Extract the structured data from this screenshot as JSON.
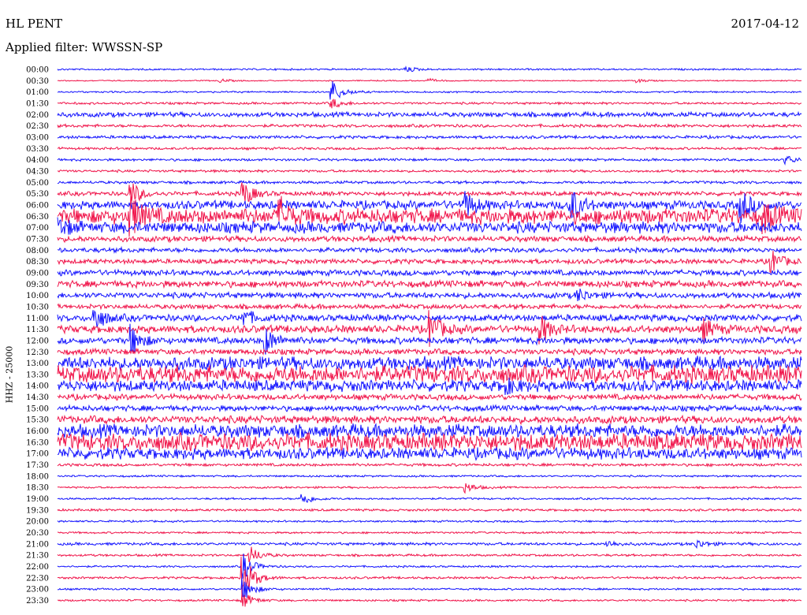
{
  "header": {
    "station": "HL PENT",
    "date": "2017-04-12",
    "filter": "Applied filter: WWSSN-SP",
    "channel": "HHZ - 25000"
  },
  "colors": {
    "trace_a": "#1414ff",
    "trace_b": "#f0144a",
    "background": "#ffffff"
  },
  "chart_data": {
    "type": "line",
    "title": "HL PENT",
    "subtitle": "Applied filter: WWSSN-SP",
    "ylabel": "HHZ - 25000",
    "xlabel": "",
    "grid": false,
    "trace_duration_minutes": 30,
    "color_cycle": [
      "#1414ff",
      "#f0144a"
    ],
    "rows": [
      {
        "time": "00:00",
        "noise": 0.9,
        "events": [
          {
            "t": 0.47,
            "amp": 3
          }
        ]
      },
      {
        "time": "00:30",
        "noise": 0.6,
        "events": [
          {
            "t": 0.22,
            "amp": 2
          },
          {
            "t": 0.5,
            "amp": 2
          },
          {
            "t": 0.78,
            "amp": 2
          }
        ]
      },
      {
        "time": "01:00",
        "noise": 0.9,
        "events": [
          {
            "t": 0.37,
            "amp": 14
          }
        ]
      },
      {
        "time": "01:30",
        "noise": 1.2,
        "events": [
          {
            "t": 0.37,
            "amp": 6
          }
        ]
      },
      {
        "time": "02:00",
        "noise": 2.5,
        "events": []
      },
      {
        "time": "02:30",
        "noise": 1.6,
        "events": []
      },
      {
        "time": "03:00",
        "noise": 1.6,
        "events": []
      },
      {
        "time": "03:30",
        "noise": 1.3,
        "events": []
      },
      {
        "time": "04:00",
        "noise": 1.3,
        "events": [
          {
            "t": 0.98,
            "amp": 5
          }
        ]
      },
      {
        "time": "04:30",
        "noise": 1.3,
        "events": []
      },
      {
        "time": "05:00",
        "noise": 1.5,
        "events": []
      },
      {
        "time": "05:30",
        "noise": 2.2,
        "events": [
          {
            "t": 0.1,
            "amp": 14
          },
          {
            "t": 0.25,
            "amp": 16
          }
        ]
      },
      {
        "time": "06:00",
        "noise": 4.5,
        "events": [
          {
            "t": 0.55,
            "amp": 15
          },
          {
            "t": 0.69,
            "amp": 22
          },
          {
            "t": 0.92,
            "amp": 18
          }
        ]
      },
      {
        "time": "06:30",
        "noise": 8,
        "events": [
          {
            "t": 0.1,
            "amp": 24
          },
          {
            "t": 0.3,
            "amp": 18
          },
          {
            "t": 0.95,
            "amp": 16
          }
        ]
      },
      {
        "time": "07:00",
        "noise": 6,
        "events": [
          {
            "t": 0.0,
            "amp": 12
          }
        ]
      },
      {
        "time": "07:30",
        "noise": 3,
        "events": []
      },
      {
        "time": "08:00",
        "noise": 2.5,
        "events": []
      },
      {
        "time": "08:30",
        "noise": 2.5,
        "events": [
          {
            "t": 0.96,
            "amp": 14
          }
        ]
      },
      {
        "time": "09:00",
        "noise": 3,
        "events": []
      },
      {
        "time": "09:30",
        "noise": 3.5,
        "events": []
      },
      {
        "time": "10:00",
        "noise": 3,
        "events": [
          {
            "t": 0.7,
            "amp": 8
          }
        ]
      },
      {
        "time": "10:30",
        "noise": 2.5,
        "events": []
      },
      {
        "time": "11:00",
        "noise": 3.5,
        "events": [
          {
            "t": 0.05,
            "amp": 16
          },
          {
            "t": 0.25,
            "amp": 10
          }
        ]
      },
      {
        "time": "11:30",
        "noise": 4,
        "events": [
          {
            "t": 0.5,
            "amp": 22
          },
          {
            "t": 0.65,
            "amp": 16
          },
          {
            "t": 0.87,
            "amp": 12
          }
        ]
      },
      {
        "time": "12:00",
        "noise": 3.5,
        "events": [
          {
            "t": 0.1,
            "amp": 18
          },
          {
            "t": 0.28,
            "amp": 16
          }
        ]
      },
      {
        "time": "12:30",
        "noise": 3,
        "events": []
      },
      {
        "time": "13:00",
        "noise": 7,
        "events": []
      },
      {
        "time": "13:30",
        "noise": 9,
        "events": []
      },
      {
        "time": "14:00",
        "noise": 6,
        "events": [
          {
            "t": 0.6,
            "amp": 10
          }
        ]
      },
      {
        "time": "14:30",
        "noise": 3,
        "events": []
      },
      {
        "time": "15:00",
        "noise": 3,
        "events": []
      },
      {
        "time": "15:30",
        "noise": 4,
        "events": []
      },
      {
        "time": "16:00",
        "noise": 7,
        "events": []
      },
      {
        "time": "16:30",
        "noise": 9,
        "events": []
      },
      {
        "time": "17:00",
        "noise": 6,
        "events": []
      },
      {
        "time": "17:30",
        "noise": 1.5,
        "events": []
      },
      {
        "time": "18:00",
        "noise": 1,
        "events": []
      },
      {
        "time": "18:30",
        "noise": 1,
        "events": [
          {
            "t": 0.55,
            "amp": 6
          }
        ]
      },
      {
        "time": "19:00",
        "noise": 1,
        "events": [
          {
            "t": 0.33,
            "amp": 8
          }
        ]
      },
      {
        "time": "19:30",
        "noise": 1.2,
        "events": []
      },
      {
        "time": "20:00",
        "noise": 1,
        "events": []
      },
      {
        "time": "20:30",
        "noise": 1,
        "events": []
      },
      {
        "time": "21:00",
        "noise": 1.5,
        "events": [
          {
            "t": 0.74,
            "amp": 4
          },
          {
            "t": 0.86,
            "amp": 5
          }
        ]
      },
      {
        "time": "21:30",
        "noise": 1.2,
        "events": [
          {
            "t": 0.26,
            "amp": 10
          }
        ]
      },
      {
        "time": "22:00",
        "noise": 1,
        "events": [
          {
            "t": 0.25,
            "amp": 16
          }
        ]
      },
      {
        "time": "22:30",
        "noise": 1.2,
        "events": [
          {
            "t": 0.25,
            "amp": 30
          }
        ]
      },
      {
        "time": "23:00",
        "noise": 1,
        "events": [
          {
            "t": 0.25,
            "amp": 14
          }
        ]
      },
      {
        "time": "23:30",
        "noise": 1,
        "events": [
          {
            "t": 0.25,
            "amp": 10
          }
        ]
      }
    ]
  }
}
